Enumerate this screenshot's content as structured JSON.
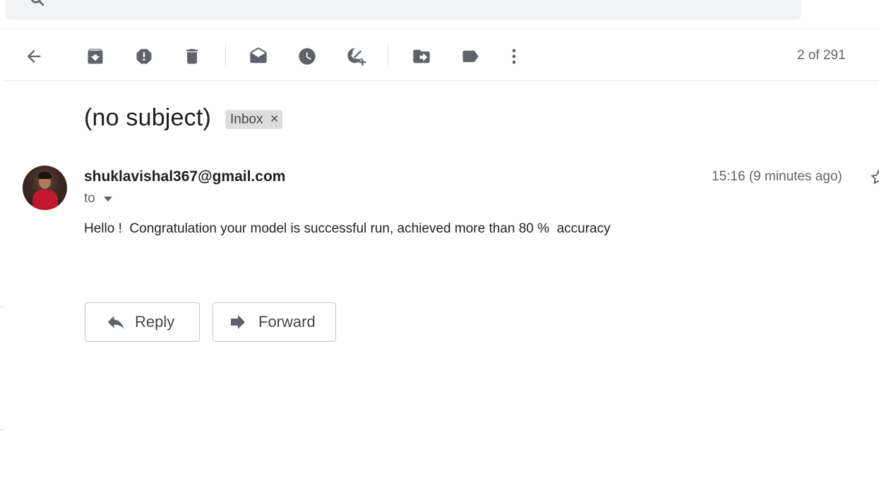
{
  "toolbar": {
    "pager_text": "2 of 291",
    "icons": [
      "back-arrow-icon",
      "archive-icon",
      "report-spam-icon",
      "delete-icon",
      "mark-unread-icon",
      "snooze-icon",
      "add-to-tasks-icon",
      "move-to-icon",
      "label-icon",
      "more-vert-icon",
      "chevron-right-icon"
    ]
  },
  "message": {
    "subject": "(no subject)",
    "label_chip": "Inbox",
    "label_remove": "×",
    "sender": "shuklavishal367@gmail.com",
    "to_label": "to",
    "timestamp": "15:16 (9 minutes ago)",
    "body": "Hello !  Congratulation your model is successful run, achieved more than 80 %  accuracy"
  },
  "actions": {
    "reply_label": "Reply",
    "forward_label": "Forward"
  }
}
